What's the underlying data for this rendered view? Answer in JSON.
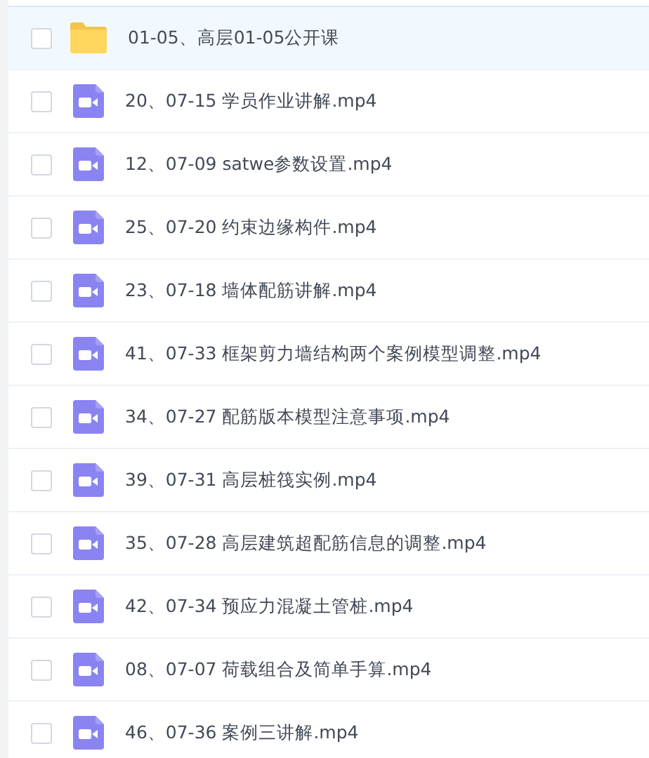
{
  "files": [
    {
      "kind": "folder",
      "name": "01-05、高层01-05公开课",
      "selected": true,
      "checked": false
    },
    {
      "kind": "video",
      "name": "20、07-15 学员作业讲解.mp4",
      "selected": false,
      "checked": false
    },
    {
      "kind": "video",
      "name": "12、07-09 satwe参数设置.mp4",
      "selected": false,
      "checked": false
    },
    {
      "kind": "video",
      "name": "25、07-20 约束边缘构件.mp4",
      "selected": false,
      "checked": false
    },
    {
      "kind": "video",
      "name": "23、07-18 墙体配筋讲解.mp4",
      "selected": false,
      "checked": false
    },
    {
      "kind": "video",
      "name": "41、07-33 框架剪力墙结构两个案例模型调整.mp4",
      "selected": false,
      "checked": false
    },
    {
      "kind": "video",
      "name": "34、07-27 配筋版本模型注意事项.mp4",
      "selected": false,
      "checked": false
    },
    {
      "kind": "video",
      "name": "39、07-31 高层桩筏实例.mp4",
      "selected": false,
      "checked": false
    },
    {
      "kind": "video",
      "name": "35、07-28 高层建筑超配筋信息的调整.mp4",
      "selected": false,
      "checked": false
    },
    {
      "kind": "video",
      "name": "42、07-34 预应力混凝土管桩.mp4",
      "selected": false,
      "checked": false
    },
    {
      "kind": "video",
      "name": "08、07-07 荷载组合及简单手算.mp4",
      "selected": false,
      "checked": false
    },
    {
      "kind": "video",
      "name": "46、07-36 案例三讲解.mp4",
      "selected": false,
      "checked": false
    }
  ]
}
